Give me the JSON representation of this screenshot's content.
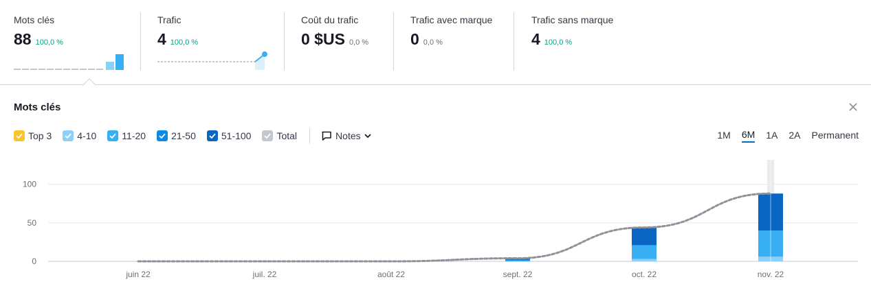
{
  "metrics": [
    {
      "label": "Mots clés",
      "value": "88",
      "change": "100,0 %",
      "positive": true
    },
    {
      "label": "Trafic",
      "value": "4",
      "change": "100,0 %",
      "positive": true
    },
    {
      "label": "Coût du trafic",
      "value": "0 $US",
      "change": "0,0 %",
      "positive": false
    },
    {
      "label": "Trafic avec marque",
      "value": "0",
      "change": "0,0 %",
      "positive": false
    },
    {
      "label": "Trafic sans marque",
      "value": "4",
      "change": "100,0 %",
      "positive": true
    }
  ],
  "panel": {
    "title": "Mots clés",
    "legend": [
      {
        "label": "Top 3",
        "color": "#fcc42c"
      },
      {
        "label": "4-10",
        "color": "#8ed0fa"
      },
      {
        "label": "11-20",
        "color": "#38aff3"
      },
      {
        "label": "21-50",
        "color": "#0d8ae5"
      },
      {
        "label": "51-100",
        "color": "#0a66c2"
      },
      {
        "label": "Total",
        "color": "#c4c7cf"
      }
    ],
    "notes_label": "Notes",
    "ranges": [
      {
        "label": "1M",
        "active": false
      },
      {
        "label": "6M",
        "active": true
      },
      {
        "label": "1A",
        "active": false
      },
      {
        "label": "2A",
        "active": false
      },
      {
        "label": "Permanent",
        "active": false
      }
    ]
  },
  "chart_data": {
    "type": "bar",
    "categories": [
      "juin 22",
      "juil. 22",
      "août 22",
      "sept. 22",
      "oct. 22",
      "nov. 22"
    ],
    "yticks": [
      0,
      50,
      100
    ],
    "ylim": [
      0,
      130
    ],
    "series": [
      {
        "name": "Top 3",
        "color": "#fcc42c",
        "values": [
          0,
          0,
          0,
          0,
          0,
          0
        ]
      },
      {
        "name": "4-10",
        "color": "#8ed0fa",
        "values": [
          0,
          0,
          0,
          0,
          3,
          6
        ]
      },
      {
        "name": "11-20",
        "color": "#38aff3",
        "values": [
          0,
          0,
          0,
          1,
          18,
          34
        ]
      },
      {
        "name": "21-50",
        "color": "#0d8ae5",
        "values": [
          0,
          0,
          0,
          1,
          0,
          0
        ]
      },
      {
        "name": "51-100",
        "color": "#0a66c2",
        "values": [
          0,
          0,
          0,
          2,
          23,
          48
        ]
      }
    ],
    "total": {
      "name": "Total",
      "color": "#8f929b",
      "values": [
        0,
        0,
        0,
        4,
        44,
        88
      ]
    },
    "highlighted_category": "nov. 22",
    "grid": true
  }
}
